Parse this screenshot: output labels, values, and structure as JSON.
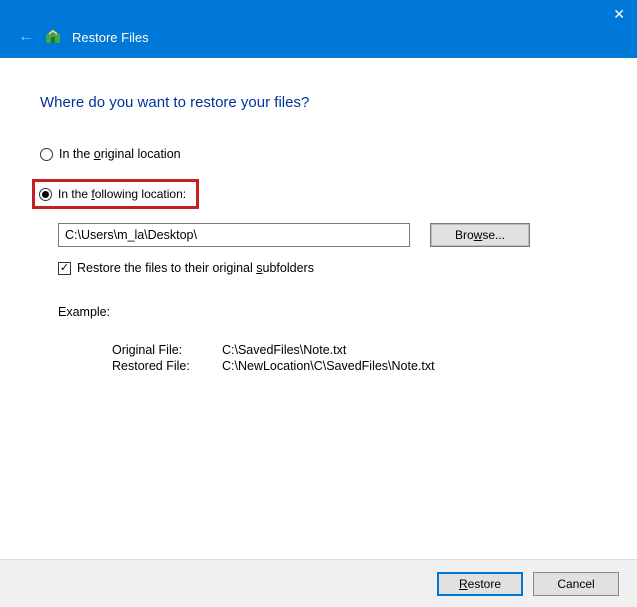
{
  "titlebar": {
    "title": "Restore Files"
  },
  "content": {
    "heading": "Where do you want to restore your files?",
    "radio_original": "In the original location",
    "radio_following": "In the following location:",
    "path_value": "C:\\Users\\m_la\\Desktop\\",
    "browse_label": "Browse...",
    "checkbox_label": "Restore the files to their original subfolders",
    "example_label": "Example:",
    "example": {
      "orig_label": "Original File:",
      "orig_value": "C:\\SavedFiles\\Note.txt",
      "rest_label": "Restored File:",
      "rest_value": "C:\\NewLocation\\C\\SavedFiles\\Note.txt"
    }
  },
  "footer": {
    "restore": "Restore",
    "cancel": "Cancel"
  }
}
